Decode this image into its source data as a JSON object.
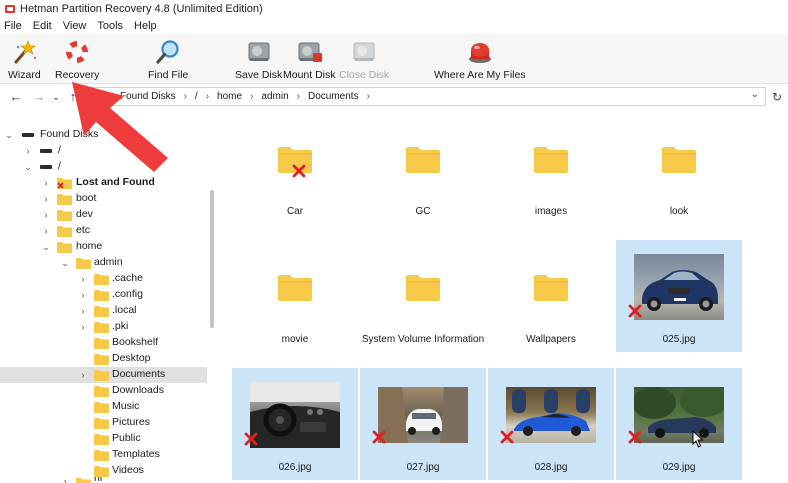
{
  "window": {
    "title": "Hetman Partition Recovery 4.8 (Unlimited Edition)"
  },
  "menu": [
    "File",
    "Edit",
    "View",
    "Tools",
    "Help"
  ],
  "toolbar": {
    "wizard": "Wizard",
    "recovery": "Recovery",
    "find_file": "Find File",
    "save_disk": "Save Disk",
    "mount_disk": "Mount Disk",
    "close_disk": "Close Disk",
    "where_are_my_files": "Where Are My Files"
  },
  "breadcrumb": [
    "Found Disks",
    "/",
    "home",
    "admin",
    "Documents"
  ],
  "tree": {
    "root": "Found Disks",
    "slash1": "/",
    "slash2": "/",
    "lost_and_found": "Lost and Found",
    "boot": "boot",
    "dev": "dev",
    "etc": "etc",
    "home": "home",
    "admin": "admin",
    "cache": ".cache",
    "config": ".config",
    "local": ".local",
    "pki": ".pki",
    "bookshelf": "Bookshelf",
    "desktop": "Desktop",
    "documents": "Documents",
    "downloads": "Downloads",
    "music": "Music",
    "pictures": "Pictures",
    "public": "Public",
    "templates": "Templates",
    "videos": "Videos",
    "ni": "ni"
  },
  "files": {
    "car": "Car",
    "gc": "GC",
    "images": "images",
    "look": "look",
    "movie": "movie",
    "svi": "System Volume Information",
    "wallpapers": "Wallpapers",
    "f025": "025.jpg",
    "f026": "026.jpg",
    "f027": "027.jpg",
    "f028": "028.jpg",
    "f029": "029.jpg"
  },
  "colors": {
    "folder": "#f7c948",
    "selection": "#cce4f7",
    "delete_mark": "#e02020",
    "arrow": "#ee3b3b"
  }
}
